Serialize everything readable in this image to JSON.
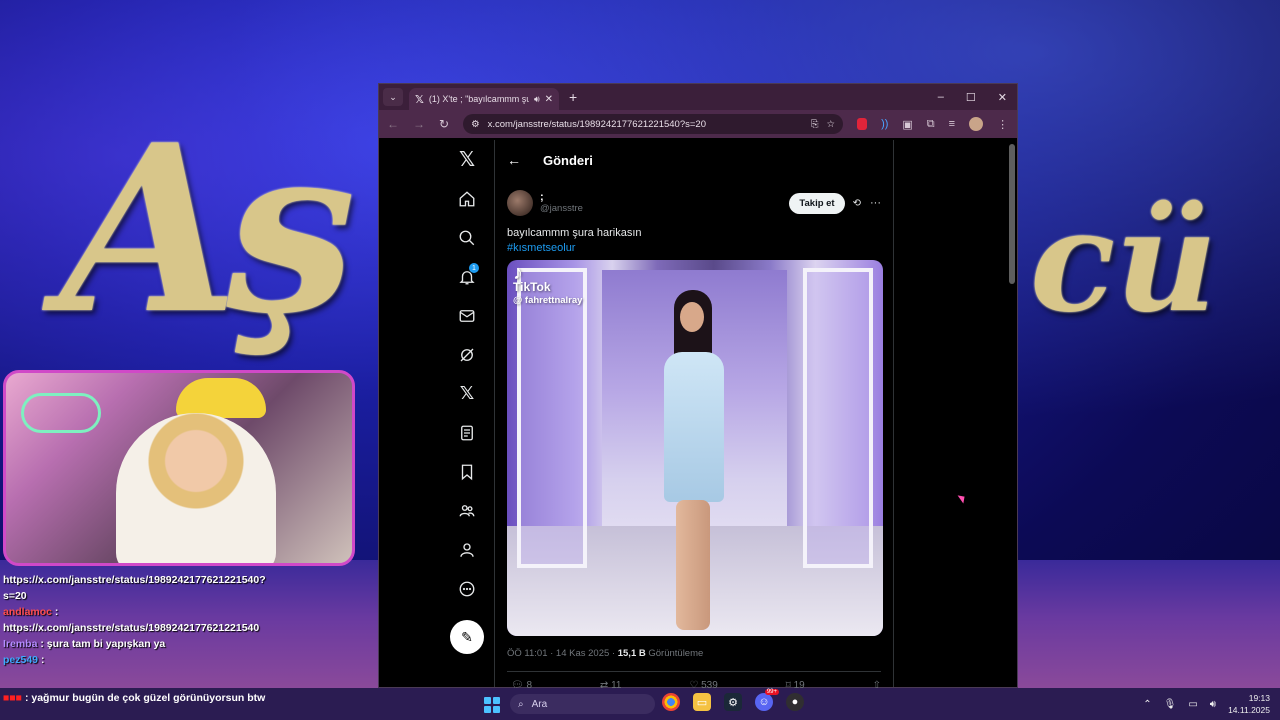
{
  "stream": {
    "title_left": "Aş",
    "title_right": "cü"
  },
  "chat": [
    {
      "user": "",
      "text": "https://x.com/jansstre/status/1989242177621221540?s=20"
    },
    {
      "user": "andlamoc",
      "text": "https://x.com/jansstre/status/1989242177621221540"
    },
    {
      "user": "Iremba",
      "text": "şura tam bi yapışkan ya"
    },
    {
      "user": "pez549",
      "text": ""
    },
    {
      "user": "",
      "text": "yağmur bugün de çok güzel görünüyorsun btw"
    }
  ],
  "browser": {
    "tab_title": "(1) X'te ; \"bayılcammm şura",
    "url": "x.com/jansstre/status/1989242177621221540?s=20",
    "window_controls": [
      "–",
      "☐",
      "✕"
    ]
  },
  "x": {
    "header_title": "Gönderi",
    "notification_count": "1",
    "author_name": ";",
    "author_handle": "@jansstre",
    "follow_label": "Takip et",
    "tweet_text": "bayılcammm şura harikasın",
    "hashtag": "#kısmetseolur",
    "tiktok_brand": "TikTok",
    "tiktok_handle": "@ fahrettnalray",
    "time_meta": "ÖÖ 11:01 · 14 Kas 2025 · ",
    "views_count": "15,1 B",
    "views_label": "Görüntüleme",
    "actions": [
      "8",
      "11",
      "539",
      "19",
      "⇧"
    ]
  },
  "taskbar": {
    "search_placeholder": "Ara",
    "time": "19:13",
    "date": "14.11.2025",
    "discord_badge": "99+"
  }
}
